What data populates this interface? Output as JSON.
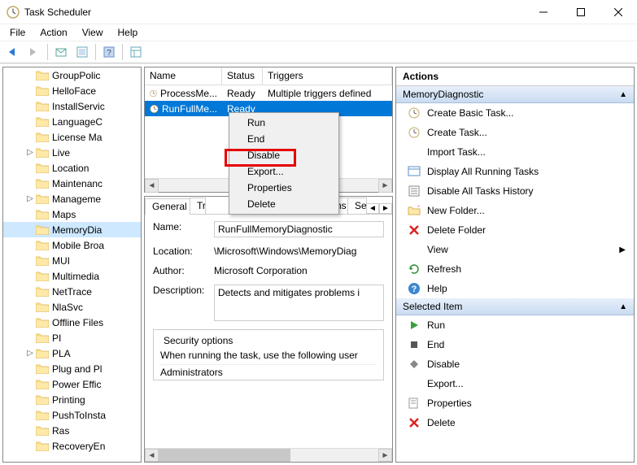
{
  "window": {
    "title": "Task Scheduler"
  },
  "menubar": [
    "File",
    "Action",
    "View",
    "Help"
  ],
  "tree": {
    "items": [
      {
        "label": "GroupPolic",
        "exp": false
      },
      {
        "label": "HelloFace",
        "exp": false
      },
      {
        "label": "InstallServic",
        "exp": false
      },
      {
        "label": "LanguageC",
        "exp": false
      },
      {
        "label": "License Ma",
        "exp": false
      },
      {
        "label": "Live",
        "exp": true
      },
      {
        "label": "Location",
        "exp": false
      },
      {
        "label": "Maintenanc",
        "exp": false
      },
      {
        "label": "Manageme",
        "exp": true
      },
      {
        "label": "Maps",
        "exp": false
      },
      {
        "label": "MemoryDia",
        "exp": false,
        "selected": true
      },
      {
        "label": "Mobile Broa",
        "exp": false
      },
      {
        "label": "MUI",
        "exp": false
      },
      {
        "label": "Multimedia",
        "exp": false
      },
      {
        "label": "NetTrace",
        "exp": false
      },
      {
        "label": "NlaSvc",
        "exp": false
      },
      {
        "label": "Offline Files",
        "exp": false
      },
      {
        "label": "PI",
        "exp": false
      },
      {
        "label": "PLA",
        "exp": true
      },
      {
        "label": "Plug and Pl",
        "exp": false
      },
      {
        "label": "Power Effic",
        "exp": false
      },
      {
        "label": "Printing",
        "exp": false
      },
      {
        "label": "PushToInsta",
        "exp": false
      },
      {
        "label": "Ras",
        "exp": false
      },
      {
        "label": "RecoveryEn",
        "exp": false
      }
    ]
  },
  "tasklist": {
    "columns": [
      "Name",
      "Status",
      "Triggers"
    ],
    "rows": [
      {
        "name": "ProcessMe...",
        "status": "Ready",
        "triggers": "Multiple triggers defined"
      },
      {
        "name": "RunFullMe...",
        "status": "Ready",
        "triggers": "",
        "selected": true
      }
    ]
  },
  "context_menu": {
    "items": [
      "Run",
      "End",
      "Disable",
      "Export...",
      "Properties",
      "Delete"
    ]
  },
  "details": {
    "tabs": [
      "General",
      "Tr",
      "ns",
      "Se"
    ],
    "name_label": "Name:",
    "name_value": "RunFullMemoryDiagnostic",
    "location_label": "Location:",
    "location_value": "\\Microsoft\\Windows\\MemoryDiag",
    "author_label": "Author:",
    "author_value": "Microsoft Corporation",
    "description_label": "Description:",
    "description_value": "Detects and mitigates problems i",
    "security_title": "Security options",
    "security_text": "When running the task, use the following user",
    "security_user": "Administrators"
  },
  "actions": {
    "title": "Actions",
    "section1": {
      "title": "MemoryDiagnostic",
      "items": [
        {
          "icon": "create-basic",
          "label": "Create Basic Task..."
        },
        {
          "icon": "create",
          "label": "Create Task..."
        },
        {
          "icon": "import",
          "label": "Import Task..."
        },
        {
          "icon": "display",
          "label": "Display All Running Tasks"
        },
        {
          "icon": "disable-hist",
          "label": "Disable All Tasks History"
        },
        {
          "icon": "new-folder",
          "label": "New Folder..."
        },
        {
          "icon": "delete-folder",
          "label": "Delete Folder"
        },
        {
          "icon": "view",
          "label": "View",
          "chevron": true
        },
        {
          "icon": "refresh",
          "label": "Refresh"
        },
        {
          "icon": "help",
          "label": "Help"
        }
      ]
    },
    "section2": {
      "title": "Selected Item",
      "items": [
        {
          "icon": "run",
          "label": "Run"
        },
        {
          "icon": "end",
          "label": "End"
        },
        {
          "icon": "disable",
          "label": "Disable"
        },
        {
          "icon": "export",
          "label": "Export..."
        },
        {
          "icon": "properties",
          "label": "Properties"
        },
        {
          "icon": "delete",
          "label": "Delete"
        }
      ]
    }
  }
}
